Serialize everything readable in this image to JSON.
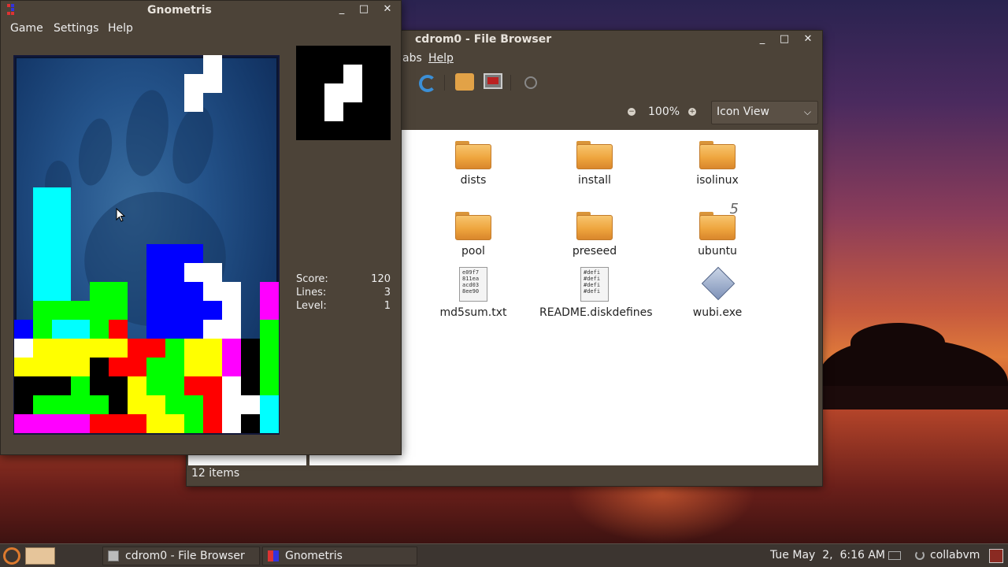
{
  "file_browser": {
    "title": "cdrom0 - File Browser",
    "menu": {
      "tabs_partial": "abs",
      "help": "Help"
    },
    "zoom": {
      "minus": "−",
      "level": "100%",
      "plus": "+"
    },
    "view_select": {
      "value": "Icon View"
    },
    "items": [
      {
        "name": "dists",
        "kind": "folder"
      },
      {
        "name": "install",
        "kind": "folder"
      },
      {
        "name": "isolinux",
        "kind": "folder"
      },
      {
        "name": "pool",
        "kind": "folder"
      },
      {
        "name": "preseed",
        "kind": "folder"
      },
      {
        "name": "ubuntu",
        "kind": "folder",
        "emblem": "5"
      },
      {
        "name": "md5sum.txt",
        "kind": "text",
        "preview": "e09f7\n811ea\nacd03\n8ee90"
      },
      {
        "name": "README.diskdefines",
        "kind": "text",
        "preview": "#defi\n#defi\n#defi\n#defi"
      },
      {
        "name": "wubi.exe",
        "kind": "exe"
      }
    ],
    "status": "12 items",
    "buttons": {
      "minimize": "_",
      "maximize": "□",
      "close": "✕"
    }
  },
  "gnometris": {
    "title": "Gnometris",
    "menu": {
      "game": "Game",
      "settings": "Settings",
      "help": "Help"
    },
    "stats": {
      "score_label": "Score:",
      "score": "120",
      "lines_label": "Lines:",
      "lines": "3",
      "level_label": "Level:",
      "level": "1"
    },
    "buttons": {
      "minimize": "_",
      "maximize": "□",
      "close": "✕"
    },
    "colors": {
      "cyan": "#00ffff",
      "green": "#00ff00",
      "red": "#ff0000",
      "blue": "#0000ff",
      "yellow": "#ffff00",
      "magenta": "#ff00ff",
      "white": "#ffffff",
      "black": "#000000"
    }
  },
  "taskbar": {
    "tasks": [
      {
        "label": "cdrom0 - File Browser"
      },
      {
        "label": "Gnometris"
      }
    ],
    "clock": "Tue May  2,  6:16 AM",
    "user": "collabvm"
  }
}
